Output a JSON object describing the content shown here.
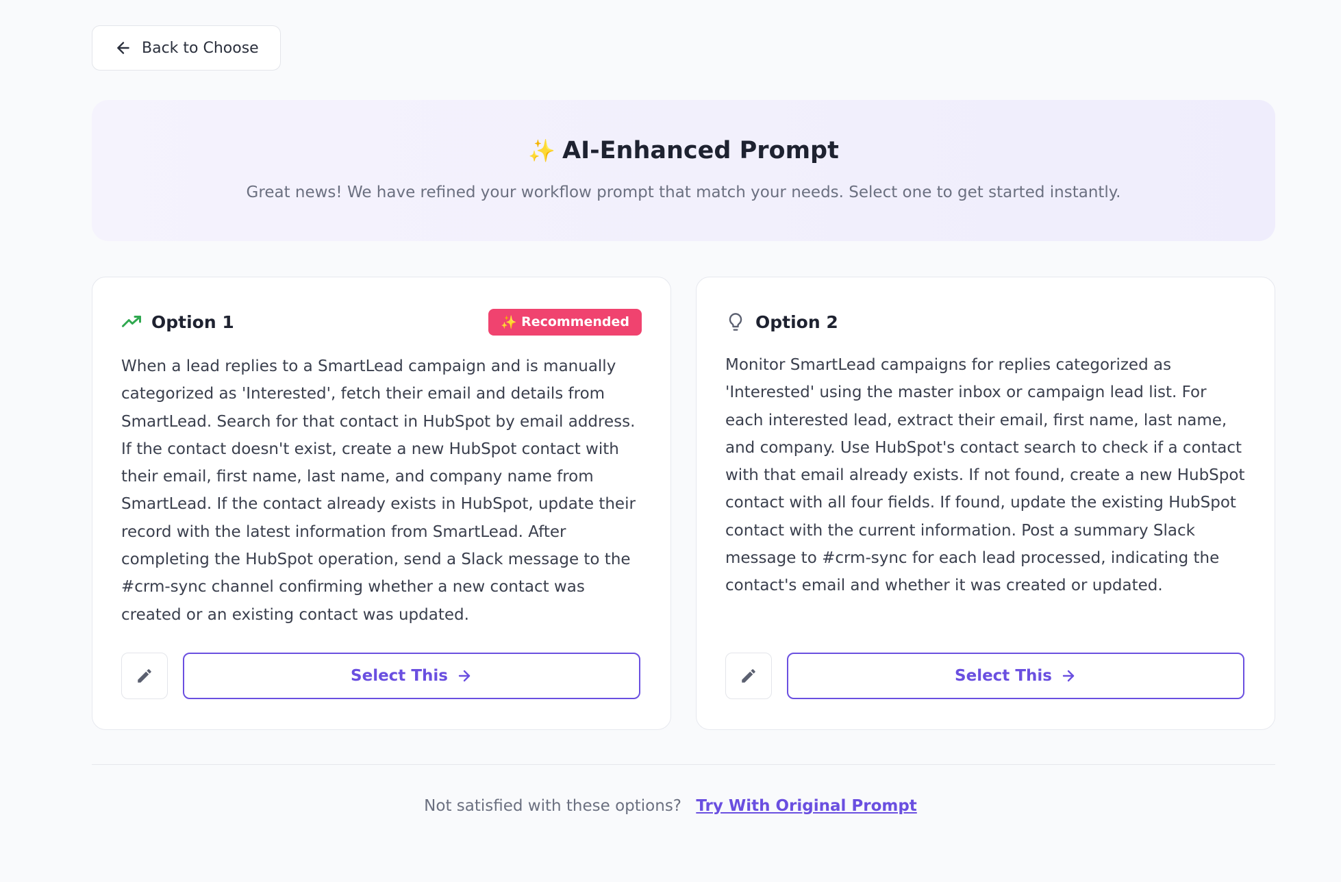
{
  "back_button": {
    "label": "Back to Choose",
    "icon": "arrow-left-icon"
  },
  "hero": {
    "sparkle": "✨",
    "title": "AI-Enhanced Prompt",
    "subtitle": "Great news! We have refined your workflow prompt that match your needs. Select one to get started instantly."
  },
  "options": [
    {
      "icon": "trending-up-icon",
      "title": "Option 1",
      "badge": "Recommended",
      "badge_sparkle": "✨",
      "text": "When a lead replies to a SmartLead campaign and is manually categorized as 'Interested', fetch their email and details from SmartLead. Search for that contact in HubSpot by email address. If the contact doesn't exist, create a new HubSpot contact with their email, first name, last name, and company name from SmartLead. If the contact already exists in HubSpot, update their record with the latest information from SmartLead. After completing the HubSpot operation, send a Slack message to the #crm-sync channel confirming whether a new contact was created or an existing contact was updated.",
      "select_label": "Select This"
    },
    {
      "icon": "lightbulb-icon",
      "title": "Option 2",
      "text": "Monitor SmartLead campaigns for replies categorized as 'Interested' using the master inbox or campaign lead list. For each interested lead, extract their email, first name, last name, and company. Use HubSpot's contact search to check if a contact with that email already exists. If not found, create a new HubSpot contact with all four fields. If found, update the existing HubSpot contact with the current information. Post a summary Slack message to #crm-sync for each lead processed, indicating the contact's email and whether it was created or updated.",
      "select_label": "Select This"
    }
  ],
  "footer": {
    "text": "Not satisfied with these options?",
    "link": "Try With Original Prompt"
  },
  "colors": {
    "accent": "#6a4fe0",
    "badge": "#f0436f",
    "trend_icon": "#2fa84f",
    "hero_bg": "#f1effc"
  }
}
